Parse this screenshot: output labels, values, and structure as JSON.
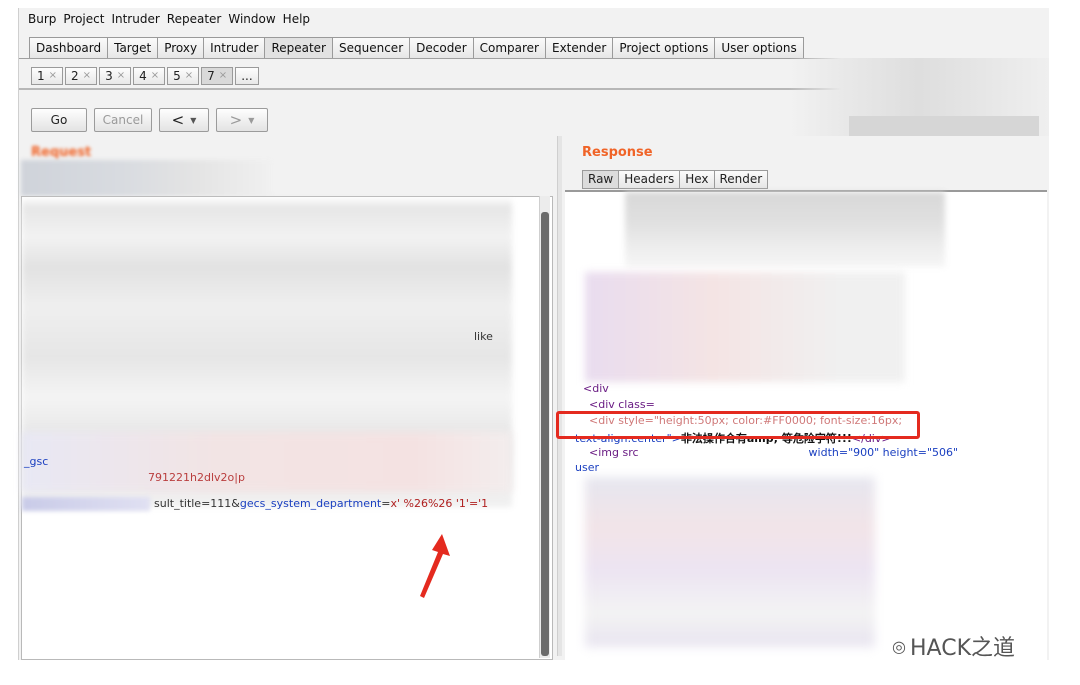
{
  "menubar": [
    "Burp",
    "Project",
    "Intruder",
    "Repeater",
    "Window",
    "Help"
  ],
  "main_tabs": [
    {
      "label": "Dashboard"
    },
    {
      "label": "Target"
    },
    {
      "label": "Proxy"
    },
    {
      "label": "Intruder"
    },
    {
      "label": "Repeater",
      "active": true
    },
    {
      "label": "Sequencer"
    },
    {
      "label": "Decoder"
    },
    {
      "label": "Comparer"
    },
    {
      "label": "Extender"
    },
    {
      "label": "Project options"
    },
    {
      "label": "User options"
    }
  ],
  "sub_tabs": [
    "1",
    "2",
    "3",
    "4",
    "5",
    "7",
    "..."
  ],
  "close_glyph": "×",
  "toolbar": {
    "go": "Go",
    "cancel": "Cancel",
    "back": "<",
    "forward": ">",
    "caret": "▼"
  },
  "request": {
    "title": "Request",
    "line_like": "like",
    "line_gsc": "_gsc",
    "line_hash": "791221h2dlv2o|p",
    "payload_key": "sult_title=111&",
    "payload_param": "gecs_system_department",
    "payload_eq": "=",
    "payload_val": "x' %26%26 '1'='1"
  },
  "response": {
    "title": "Response",
    "tabs": [
      "Raw",
      "Headers",
      "Hex",
      "Render"
    ],
    "line1": "<div",
    "line2": "<div class=",
    "line3": "<div style=\"height:50px; color:#FF0000; font-size:16px;",
    "line4_a": "text-align:center\">",
    "line4_b": "非法操作合有amp; 等危险字符!!!",
    "line4_c": "</div>",
    "line5_a": "<img src",
    "line5_b": "width=\"900\" height=\"506\"",
    "line6": "user"
  },
  "watermark": "HACK之道",
  "colors": {
    "accent": "#f06428",
    "highlight": "#e42a1f",
    "attr_blue": "#1a3fc0",
    "string_red": "#b02020"
  }
}
